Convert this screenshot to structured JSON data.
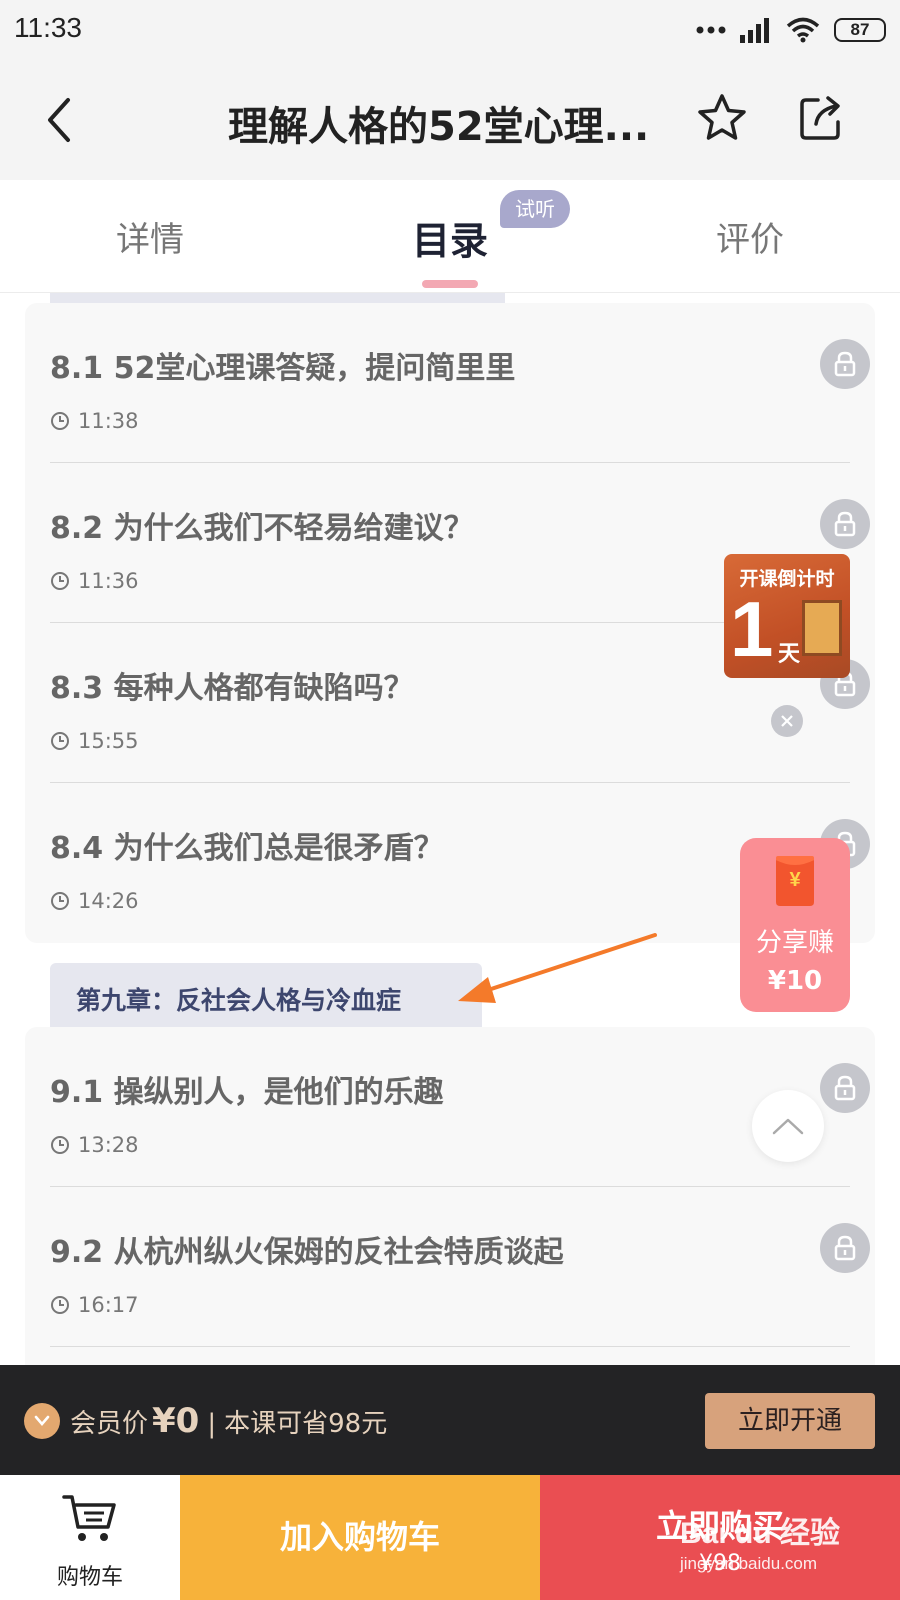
{
  "status_bar": {
    "time": "11:33",
    "battery": "87"
  },
  "header": {
    "title": "理解人格的52堂心理..."
  },
  "tabs": {
    "detail": "详情",
    "catalog": "目录",
    "catalog_badge": "试听",
    "review": "评价",
    "active": "目录"
  },
  "card1": {
    "lessons": [
      {
        "title": "8.1 52堂心理课答疑，提问简里里",
        "duration": "11:38"
      },
      {
        "title": "8.2 为什么我们不轻易给建议？",
        "duration": "11:36"
      },
      {
        "title": "8.3 每种人格都有缺陷吗？",
        "duration": "15:55"
      },
      {
        "title": "8.4 为什么我们总是很矛盾？",
        "duration": "14:26"
      }
    ]
  },
  "chapter9": {
    "label": "第九章：反社会人格与冷血症"
  },
  "card2": {
    "lessons": [
      {
        "title": "9.1 操纵别人，是他们的乐趣",
        "duration": "13:28"
      },
      {
        "title": "9.2 从杭州纵火保姆的反社会特质谈起",
        "duration": "16:17"
      }
    ]
  },
  "countdown_widget": {
    "title": "开课倒计时",
    "number": "1",
    "unit": "天"
  },
  "share_widget": {
    "label": "分享赚",
    "amount": "¥10"
  },
  "member_bar": {
    "label": "会员价",
    "price": "¥0",
    "separator": "|",
    "saving": "本课可省98元",
    "button": "立即开通"
  },
  "bottom_bar": {
    "cart_label": "购物车",
    "add_to_cart": "加入购物车",
    "buy_now": "立即购买",
    "buy_price": "¥98"
  },
  "watermark": {
    "logo": "Bai du 经验",
    "url": "jingyan.baidu.com"
  },
  "colors": {
    "accent_pink": "#f3a8b3",
    "add_cart": "#f7b23a",
    "buy_now": "#ea4e52",
    "member_button": "#d7a27c",
    "annotation_arrow": "#f47a2a"
  }
}
